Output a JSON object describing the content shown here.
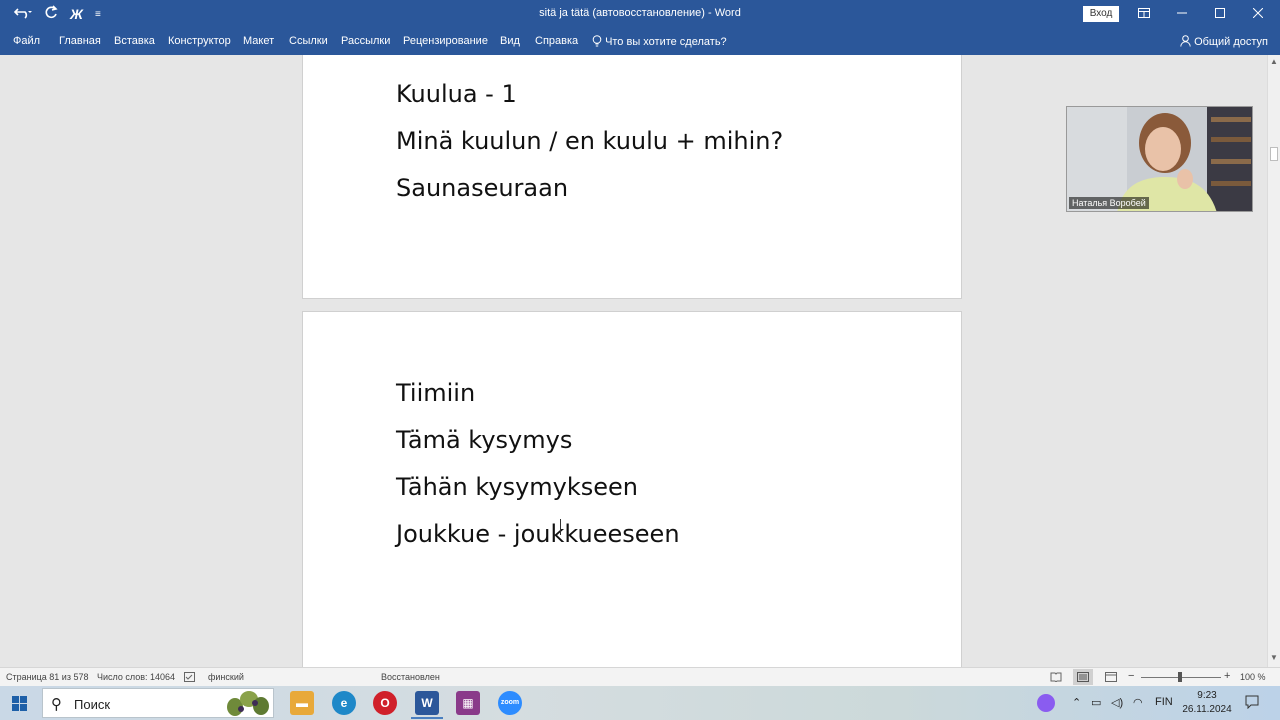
{
  "window": {
    "title": "sitä ja tätä (автовосстановление)  -  Word",
    "signin_label": "Вход",
    "qat": {
      "bold_label": "Ж",
      "more_label": "≡"
    }
  },
  "ribbon": {
    "tabs": [
      "Файл",
      "Главная",
      "Вставка",
      "Конструктор",
      "Макет",
      "Ссылки",
      "Рассылки",
      "Рецензирование",
      "Вид",
      "Справка"
    ],
    "tell_me": "Что вы хотите сделать?",
    "share": "Общий доступ"
  },
  "document": {
    "page1_lines": [
      "Kuulua  - 1",
      "Minä kuulun  / en kuulu  + mihin?",
      "Saunaseuraan"
    ],
    "page2_lines": [
      "Tiimiin",
      "Tämä kysymys",
      "Tähän kysymykseen",
      "Joukkue  - joukkueeseen"
    ]
  },
  "video": {
    "participant_name": "Наталья Воробей"
  },
  "statusbar": {
    "page": "Страница 81 из 578",
    "words": "Число слов: 14064",
    "language": "финский",
    "recovered": "Восстановлен",
    "zoom": "100 %"
  },
  "taskbar": {
    "search_placeholder": "Поиск",
    "lang": "FIN",
    "time": "9:23",
    "date": "26.11.2024"
  },
  "colors": {
    "word_blue": "#2b579a",
    "page_bg": "#ffffff",
    "canvas_bg": "#e6e6e6"
  }
}
